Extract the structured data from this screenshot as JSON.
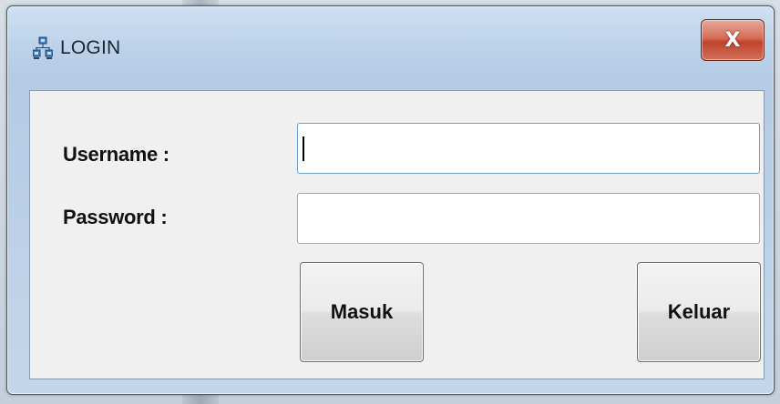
{
  "window": {
    "title": "LOGIN",
    "close_label": "X"
  },
  "form": {
    "username_label": "Username :",
    "password_label": "Password :",
    "username_value": "",
    "password_value": ""
  },
  "buttons": {
    "submit_label": "Masuk",
    "exit_label": "Keluar"
  },
  "icons": {
    "app": "network-computers-icon",
    "close": "close-icon"
  },
  "colors": {
    "title_bar": "#bdd3ea",
    "close_button": "#c0442c",
    "client_area": "#f0f0f0",
    "focused_field_border": "#6f9ed4"
  }
}
